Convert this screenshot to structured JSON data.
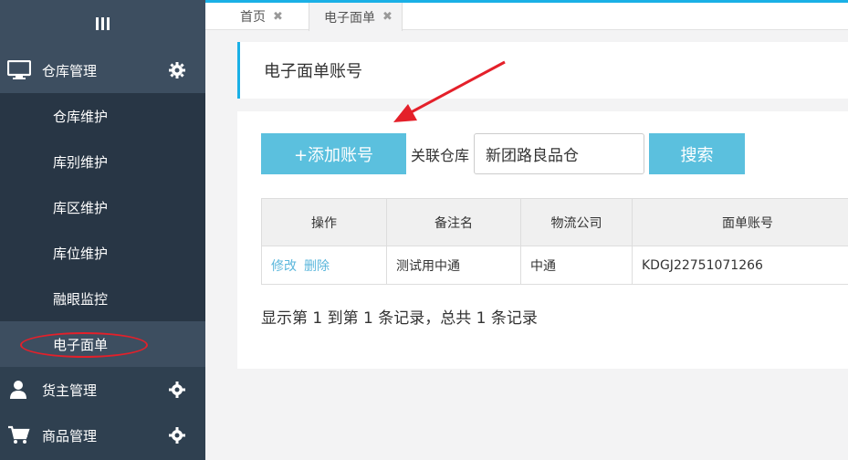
{
  "sidebar": {
    "groups": [
      {
        "label": "仓库管理",
        "icon": "monitor-icon"
      },
      {
        "label": "货主管理",
        "icon": "user-icon"
      },
      {
        "label": "商品管理",
        "icon": "cart-icon"
      }
    ],
    "items": [
      "仓库维护",
      "库别维护",
      "库区维护",
      "库位维护",
      "融眼监控",
      "电子面单"
    ]
  },
  "tabs": [
    {
      "label": "首页"
    },
    {
      "label": "电子面单"
    }
  ],
  "page_title": "电子面单账号",
  "toolbar": {
    "add_label": "+添加账号",
    "warehouse_label": "关联仓库",
    "warehouse_value": "新团路良品仓",
    "search_label": "搜索"
  },
  "table": {
    "headers": [
      "操作",
      "备注名",
      "物流公司",
      "面单账号"
    ],
    "rows": [
      {
        "ops": [
          "修改",
          "删除"
        ],
        "remark": "测试用中通",
        "company": "中通",
        "account": "KDGJ22751071266"
      }
    ]
  },
  "summary": "显示第 1 到第 1 条记录，总共 1 条记录",
  "colors": {
    "accent": "#5bc0de",
    "sidebar": "#2f4050",
    "annotation": "#e4202a"
  }
}
